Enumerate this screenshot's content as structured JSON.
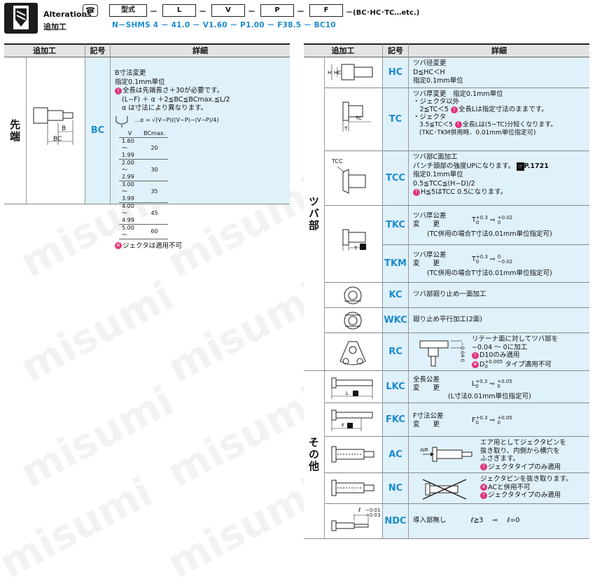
{
  "header": {
    "title_en": "Alterations",
    "title_ja": "追加工",
    "code_boxes": [
      "型式",
      "L",
      "V",
      "P",
      "F"
    ],
    "code_suffix": "－(BC･HC･TC…etc.)",
    "example": "N－SHMS 4 － 41.0 － V1.60 － P1.00 － F38.5 － BC10"
  },
  "table_headers": {
    "alteration": "追加工",
    "code": "記号",
    "detail": "詳細"
  },
  "left": {
    "group": "先端",
    "row": {
      "code": "BC",
      "fig_labels": [
        "B",
        "BC"
      ],
      "lines": [
        "B寸法変更",
        "指定0.1mm単位"
      ],
      "note1": "全長は先端長さ＋30が必要です。",
      "formula1": "(L−F) ＋ α ＋2≦BC≦BCmax.≦L/2",
      "formula2": "α は寸法により異なります。",
      "formula3": "…α = √(V−P)((V−P)−(V−P)/4)",
      "table_header": [
        "V",
        "BCmax."
      ],
      "table_rows": [
        [
          "1.60～1.99",
          "20"
        ],
        [
          "2.00～2.99",
          "30"
        ],
        [
          "3.00～3.99",
          "35"
        ],
        [
          "4.00～4.99",
          "45"
        ],
        [
          "5.00～",
          "60"
        ]
      ],
      "ng": "ジェクタは適用不可"
    }
  },
  "right": {
    "group1": "ツバ部",
    "group2": "その他",
    "rows": [
      {
        "code": "HC",
        "lines": [
          "ツバ径変更",
          "D≦HC＜H",
          "指定0.1mm単位"
        ]
      },
      {
        "code": "TC",
        "lines": [
          "ツバ厚変更　指定0.1mm単位",
          "・ジェクタ以外",
          "　2≦TC＜5",
          "全長Lは指定寸法のままです。",
          "・ジェクタ",
          "　3.5≦TC＜5",
          "全長Lは(5−TC)分短くなります。",
          "　(TKC･TKM併用時、0.01mm単位指定可)"
        ]
      },
      {
        "code": "TCC",
        "fig_label": "TCC",
        "lines": [
          "ツバ部C面加工",
          "パンチ頭部の強度UPになります。",
          "P.1721",
          "指定0.1mm単位",
          "0.5≦TCC≦(H−D)/2",
          "H≦5はTCC 0.5になります。"
        ]
      },
      {
        "code": "TKC",
        "lines": [
          "ツバ厚公差",
          "変　　更",
          "T",
          "+0.3",
          "0",
          "⇨",
          "+0.02",
          "0",
          "(TC併用の場合T寸法0.01mm単位指定可)"
        ]
      },
      {
        "code": "TKM",
        "lines": [
          "ツバ厚公差",
          "変　　更",
          "T",
          "+0.3",
          "0",
          "⇨",
          "0",
          "−0.02",
          "(TC併用の場合T寸法0.01mm単位指定可)"
        ]
      },
      {
        "code": "KC",
        "lines": [
          "ツバ部廻り止め一面加工"
        ]
      },
      {
        "code": "WKC",
        "lines": [
          "廻り止め平行加工(2面)"
        ]
      },
      {
        "code": "RC",
        "lines": [
          "リテーナ面に対してツバ部を",
          "−0.04 ～ 0に加工",
          "D10のみ適用",
          "D",
          "+0.005",
          "0",
          "タイプ適用不可"
        ],
        "fig_label": "−0.04 0"
      },
      {
        "code": "LKC",
        "lines": [
          "全長公差",
          "変　　更",
          "L",
          "+0.3",
          "0",
          "⇨",
          "+0.05",
          "0",
          "(L寸法0.01mm単位指定可)"
        ]
      },
      {
        "code": "FKC",
        "lines": [
          "F寸法公差",
          "変　　更",
          "F",
          "+0.3",
          "0",
          "⇨",
          "+0.05",
          "0"
        ]
      },
      {
        "code": "AC",
        "fig_label": "AIR",
        "lines": [
          "エア用としてジェクタピンを",
          "抜き取り、内側から横穴を",
          "ふさぎます。",
          "ジェクタタイプのみ適用"
        ]
      },
      {
        "code": "NC",
        "lines": [
          "ジェクタピンを抜き取ります。",
          "ACと併用不可",
          "ジェクタタイプのみ適用"
        ]
      },
      {
        "code": "NDC",
        "fig_label": "ℓ",
        "fig_tol": [
          "−0.01",
          "−0.03"
        ],
        "lines": [
          "導入部無し",
          "ℓ≧3",
          "⇨",
          "ℓ=0"
        ]
      }
    ]
  },
  "watermark": "misumi"
}
